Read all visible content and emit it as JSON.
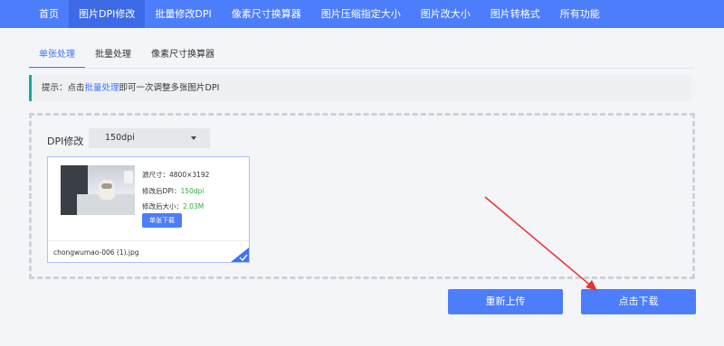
{
  "nav": {
    "items": [
      {
        "label": "首页"
      },
      {
        "label": "图片DPI修改"
      },
      {
        "label": "批量修改DPI"
      },
      {
        "label": "像素尺寸换算器"
      },
      {
        "label": "图片压缩指定大小"
      },
      {
        "label": "图片改大小"
      },
      {
        "label": "图片转格式"
      },
      {
        "label": "所有功能"
      }
    ],
    "active_index": 1
  },
  "subtabs": {
    "items": [
      {
        "label": "单张处理"
      },
      {
        "label": "批量处理"
      },
      {
        "label": "像素尺寸换算器"
      }
    ],
    "active_index": 0
  },
  "tip": {
    "prefix": "提示：点击",
    "link": "批量处理",
    "suffix": "即可一次调整多张图片DPI"
  },
  "dpi": {
    "label": "DPI修改",
    "selected": "150dpi"
  },
  "card": {
    "original_size_label": "源尺寸：",
    "original_size_value": "4800×3192",
    "new_dpi_label": "修改后DPI：",
    "new_dpi_value": "150dpi",
    "new_size_label": "修改后大小：",
    "new_size_value": "2.03M",
    "download_single_label": "单张下载",
    "filename": "chongwumao-006 (1).jpg"
  },
  "buttons": {
    "reupload_label": "重新上传",
    "download_label": "点击下载"
  },
  "colors": {
    "brand": "#4c7dfb",
    "tip_accent": "#17a99a",
    "green_value": "#2fae3b",
    "arrow": "#e8322b"
  },
  "icons": {
    "dropdown": "caret-down-icon",
    "selected_corner": "check-corner-icon"
  }
}
